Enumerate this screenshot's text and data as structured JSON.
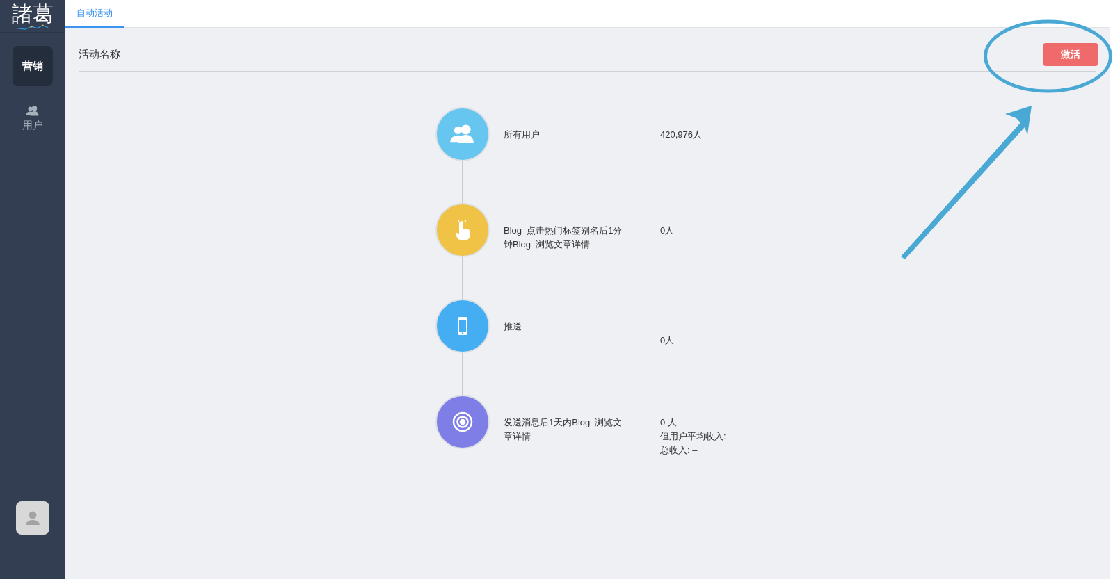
{
  "logo": {
    "text": "諸葛"
  },
  "sidebar": {
    "items": [
      {
        "kind": "text",
        "label": "营销",
        "selected": true
      },
      {
        "kind": "users",
        "label": "用户",
        "selected": false
      }
    ]
  },
  "tabs": [
    {
      "label": "自动活动",
      "selected": true
    }
  ],
  "header": {
    "title": "活动名称",
    "button": "激活"
  },
  "steps": [
    {
      "kind": "users",
      "color": "#66c6f0",
      "label": "所有用户",
      "values": [
        "420,976人"
      ]
    },
    {
      "kind": "touch",
      "color": "#f0c246",
      "label": "Blog–点击热门标签别名后1分钟Blog–浏览文章详情",
      "values": [
        "0人"
      ]
    },
    {
      "kind": "phone",
      "color": "#45aef2",
      "label": "推送",
      "values": [
        "–",
        "0人"
      ]
    },
    {
      "kind": "target",
      "color": "#7f7ee6",
      "label": "发送消息后1天内Blog–浏览文章详情",
      "values": [
        "0 人",
        "但用户平均收入: –",
        "总收入: –"
      ]
    }
  ]
}
